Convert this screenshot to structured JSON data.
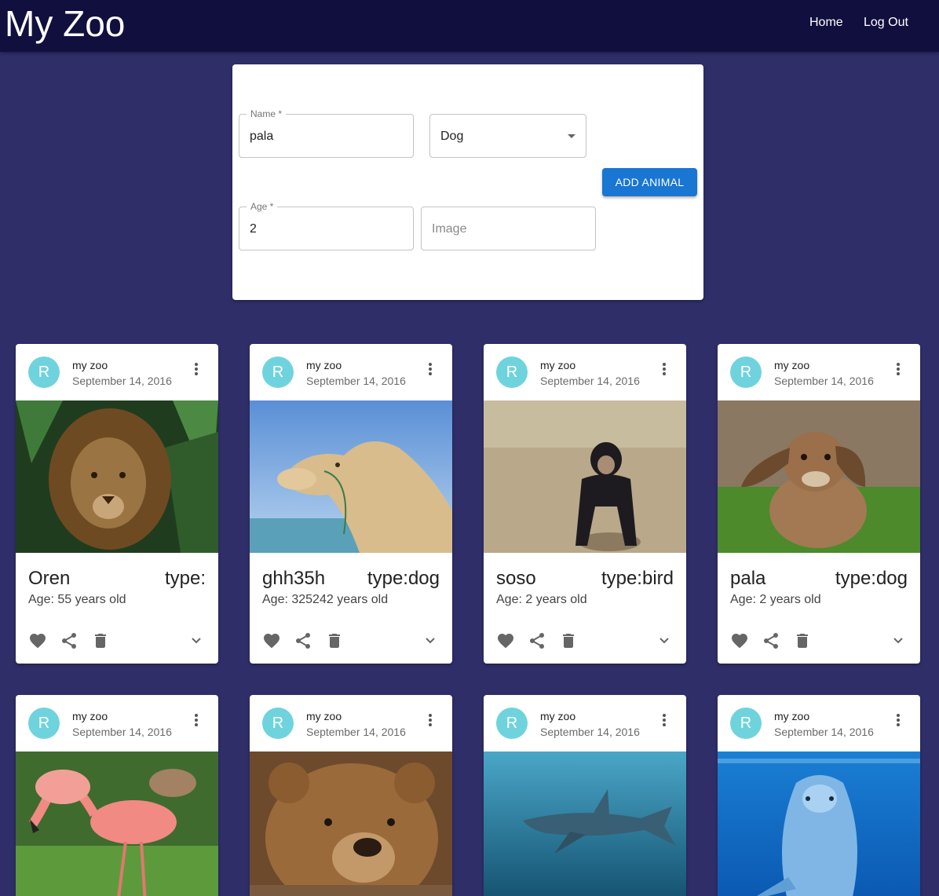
{
  "app": {
    "title": "My Zoo"
  },
  "nav": {
    "home": "Home",
    "logout": "Log Out"
  },
  "form": {
    "name_label": "Name *",
    "name_value": "pala",
    "type_value": "Dog",
    "age_label": "Age *",
    "age_value": "2",
    "image_placeholder": "Image",
    "add_button": "ADD ANIMAL"
  },
  "colors": {
    "appbar": "#110f3e",
    "background": "#302e69",
    "avatar": "#6fd3dd",
    "button": "#1976d2"
  },
  "cards": [
    {
      "avatar": "R",
      "title": "my zoo",
      "date": "September 14, 2016",
      "name": "Oren",
      "type": "type:",
      "age": "Age: 55 years old",
      "image": "lion"
    },
    {
      "avatar": "R",
      "title": "my zoo",
      "date": "September 14, 2016",
      "name": "ghh35h",
      "type": "type:dog",
      "age": "Age: 325242 years old",
      "image": "camel"
    },
    {
      "avatar": "R",
      "title": "my zoo",
      "date": "September 14, 2016",
      "name": "soso",
      "type": "type:bird",
      "age": "Age: 2 years old",
      "image": "chimpanzee"
    },
    {
      "avatar": "R",
      "title": "my zoo",
      "date": "September 14, 2016",
      "name": "pala",
      "type": "type:dog",
      "age": "Age: 2 years old",
      "image": "rabbit"
    },
    {
      "avatar": "R",
      "title": "my zoo",
      "date": "September 14, 2016",
      "image": "flamingo"
    },
    {
      "avatar": "R",
      "title": "my zoo",
      "date": "September 14, 2016",
      "image": "bear"
    },
    {
      "avatar": "R",
      "title": "my zoo",
      "date": "September 14, 2016",
      "image": "shark"
    },
    {
      "avatar": "R",
      "title": "my zoo",
      "date": "September 14, 2016",
      "image": "dolphin"
    }
  ]
}
